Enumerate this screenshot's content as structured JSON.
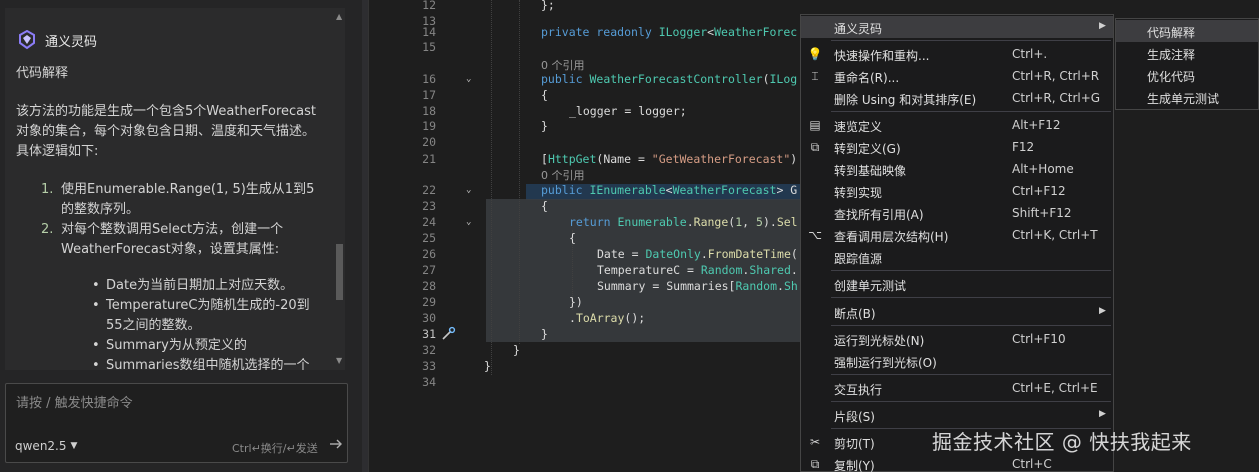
{
  "chat": {
    "app_title": "通义灵码",
    "section_title": "代码解释",
    "description": "该方法的功能是生成一个包含5个WeatherForecast对象的集合，每个对象包含日期、温度和天气描述。具体逻辑如下:",
    "steps": [
      {
        "num": "1.",
        "text": "使用Enumerable.Range(1, 5)生成从1到5的整数序列。"
      },
      {
        "num": "2.",
        "text": "对每个整数调用Select方法，创建一个WeatherForecast对象，设置其属性:"
      }
    ],
    "bullets": [
      "Date为当前日期加上对应天数。",
      "TemperatureC为随机生成的-20到55之间的整数。",
      "Summary为从预定义的",
      "Summaries数组中随机选择的一个"
    ],
    "input_placeholder": "请按 / 触发快捷命令",
    "model": "qwen2.5",
    "send_hint": "Ctrl↵换行/↵发送"
  },
  "editor": {
    "current_line": "31",
    "lines": [
      {
        "n": "12",
        "code": "};"
      },
      {
        "n": "13",
        "code": ""
      },
      {
        "n": "14",
        "code": "private readonly ILogger<WeatherForec"
      },
      {
        "n": "15",
        "code": ""
      },
      {
        "n": "16",
        "code": "public WeatherForecastController(ILog"
      },
      {
        "n": "17",
        "code": "{"
      },
      {
        "n": "18",
        "code": "_logger = logger;"
      },
      {
        "n": "19",
        "code": "}"
      },
      {
        "n": "20",
        "code": ""
      },
      {
        "n": "21",
        "code": "[HttpGet(Name = \"GetWeatherForecast\")"
      },
      {
        "n": "22",
        "code": "public IEnumerable<WeatherForecast> G"
      },
      {
        "n": "23",
        "code": "{"
      },
      {
        "n": "24",
        "code": "return Enumerable.Range(1, 5).Sel"
      },
      {
        "n": "25",
        "code": "{"
      },
      {
        "n": "26",
        "code": "Date = DateOnly.FromDateTime("
      },
      {
        "n": "27",
        "code": "TemperatureC = Random.Shared."
      },
      {
        "n": "28",
        "code": "Summary = Summaries[Random.Sh"
      },
      {
        "n": "29",
        "code": "})"
      },
      {
        "n": "30",
        "code": ".ToArray();"
      },
      {
        "n": "31",
        "code": "}"
      },
      {
        "n": "32",
        "code": "}"
      },
      {
        "n": "33",
        "code": "}"
      },
      {
        "n": "34",
        "code": ""
      }
    ],
    "references_label_1": "0 个引用",
    "references_label_2": "0 个引用"
  },
  "context_menu": {
    "items": [
      {
        "label": "通义灵码",
        "shortcut": "",
        "icon": "",
        "submenu": true
      },
      {
        "label": "快速操作和重构...",
        "shortcut": "Ctrl+.",
        "icon": "lightbulb-icon",
        "submenu": false
      },
      {
        "label": "重命名(R)...",
        "shortcut": "Ctrl+R, Ctrl+R",
        "icon": "rename-icon",
        "submenu": false
      },
      {
        "label": "删除 Using 和对其排序(E)",
        "shortcut": "Ctrl+R, Ctrl+G",
        "icon": "",
        "submenu": false
      },
      {
        "label": "速览定义",
        "shortcut": "Alt+F12",
        "icon": "peek-definition-icon",
        "submenu": false
      },
      {
        "label": "转到定义(G)",
        "shortcut": "F12",
        "icon": "go-to-definition-icon",
        "submenu": false
      },
      {
        "label": "转到基础映像",
        "shortcut": "Alt+Home",
        "icon": "",
        "submenu": false
      },
      {
        "label": "转到实现",
        "shortcut": "Ctrl+F12",
        "icon": "",
        "submenu": false
      },
      {
        "label": "查找所有引用(A)",
        "shortcut": "Shift+F12",
        "icon": "",
        "submenu": false
      },
      {
        "label": "查看调用层次结构(H)",
        "shortcut": "Ctrl+K, Ctrl+T",
        "icon": "call-hierarchy-icon",
        "submenu": false
      },
      {
        "label": "跟踪值源",
        "shortcut": "",
        "icon": "",
        "submenu": false
      },
      {
        "label": "创建单元测试",
        "shortcut": "",
        "icon": "",
        "submenu": false
      },
      {
        "label": "断点(B)",
        "shortcut": "",
        "icon": "",
        "submenu": true
      },
      {
        "label": "运行到光标处(N)",
        "shortcut": "Ctrl+F10",
        "icon": "",
        "submenu": false
      },
      {
        "label": "强制运行到光标(O)",
        "shortcut": "",
        "icon": "",
        "submenu": false
      },
      {
        "label": "交互执行",
        "shortcut": "Ctrl+E, Ctrl+E",
        "icon": "",
        "submenu": false
      },
      {
        "label": "片段(S)",
        "shortcut": "",
        "icon": "",
        "submenu": true
      },
      {
        "label": "剪切(T)",
        "shortcut": "",
        "icon": "scissors-icon",
        "submenu": false
      },
      {
        "label": "复制(Y)",
        "shortcut": "Ctrl+C",
        "icon": "copy-icon",
        "submenu": false
      }
    ]
  },
  "submenu": {
    "items": [
      "代码解释",
      "生成注释",
      "优化代码",
      "生成单元测试"
    ]
  },
  "watermark": "掘金技术社区 @ 快扶我起来",
  "colors": {
    "background": "#1e1e1e",
    "menu_background": "#1b1b1c",
    "menu_hover": "#3d3d40",
    "keyword": "#569cd6",
    "type": "#4ec9b0",
    "method": "#dcdcaa",
    "string": "#d69d85"
  }
}
